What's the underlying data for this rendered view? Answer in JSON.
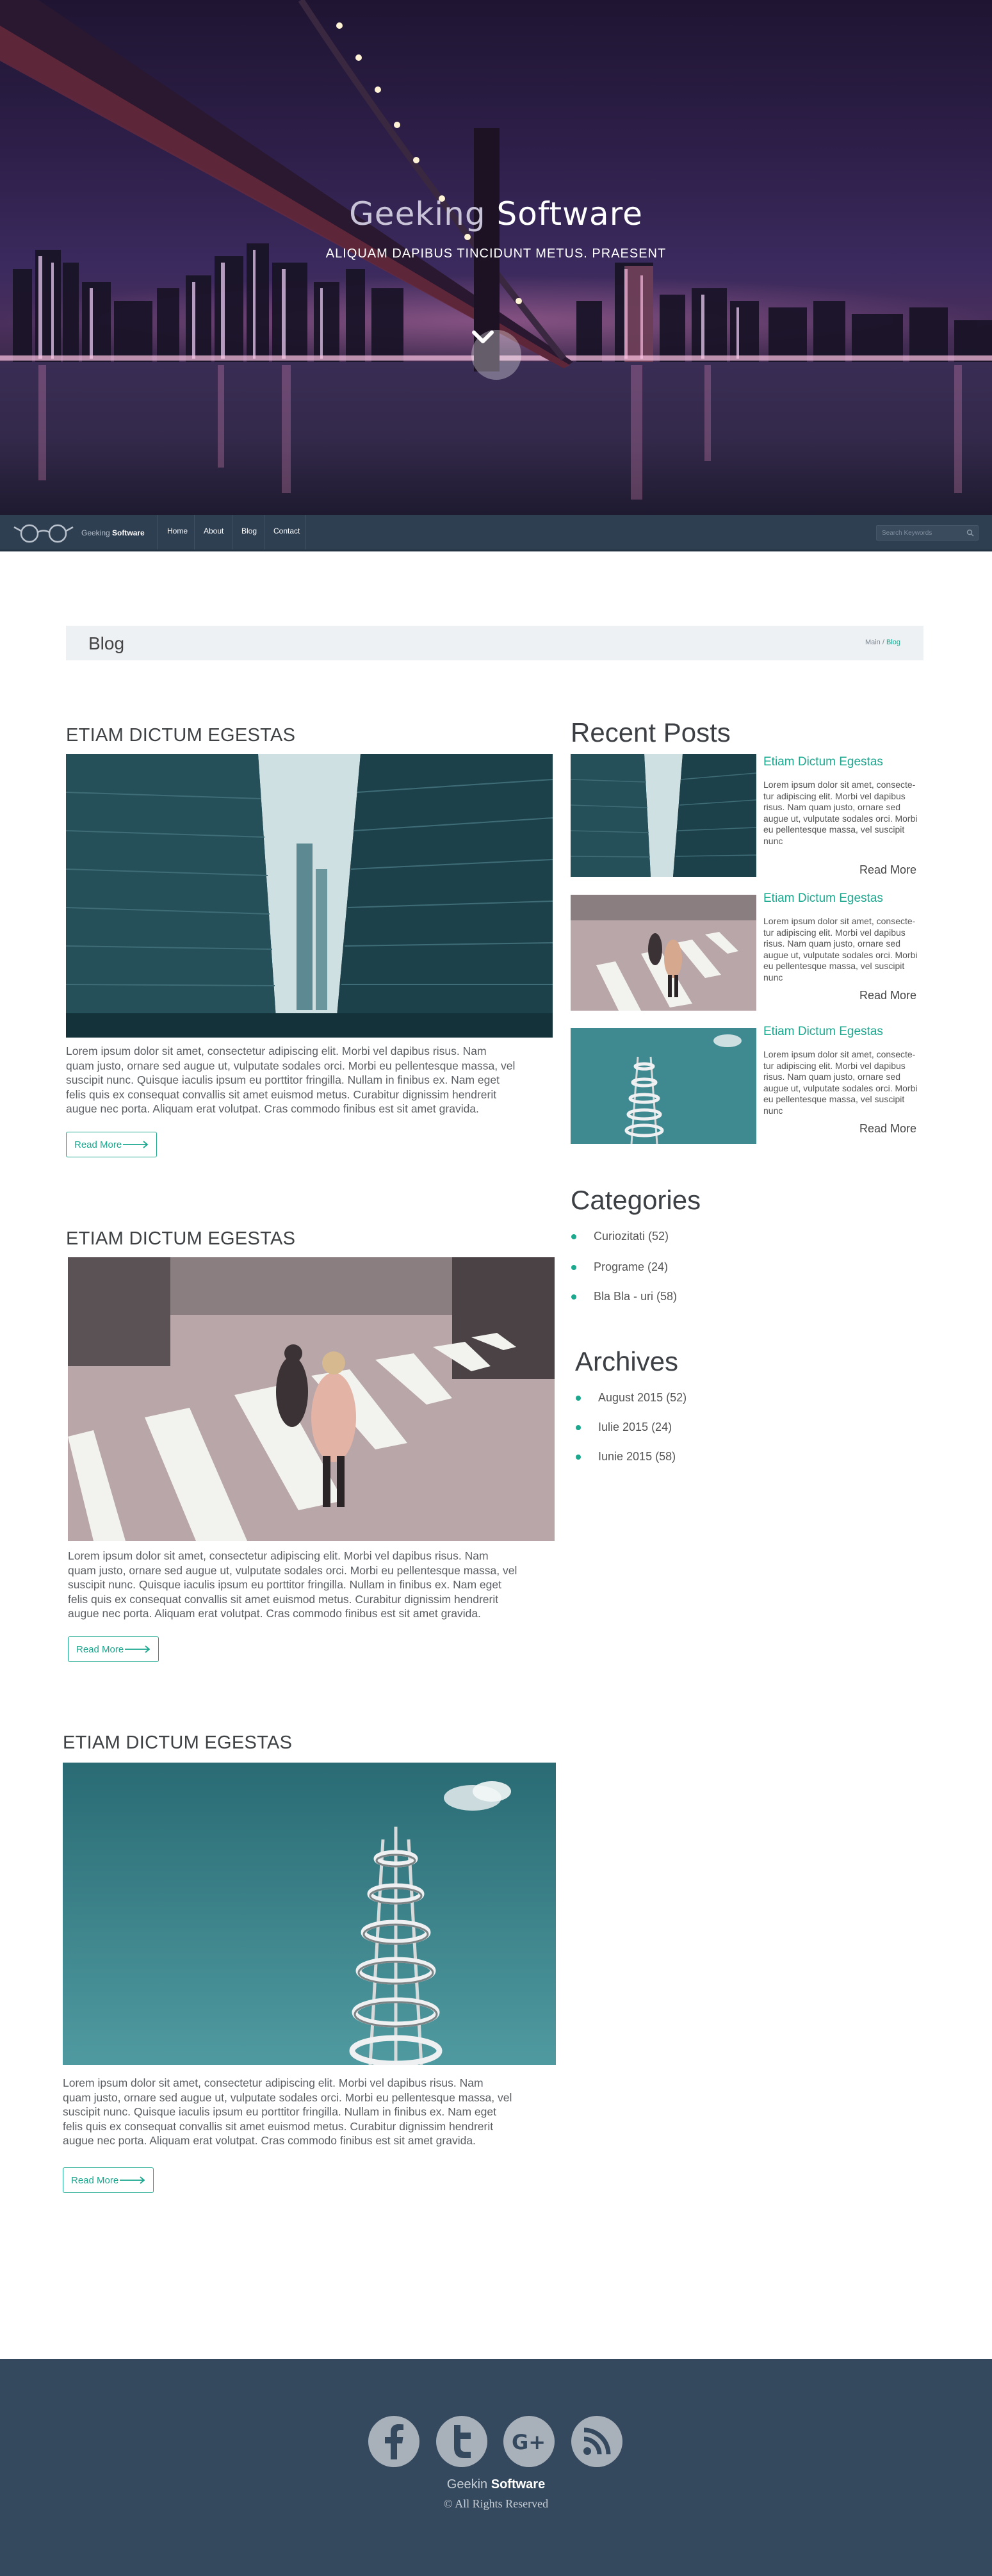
{
  "hero": {
    "title_light": "Geeking",
    "title_bold": " Software",
    "subtitle": "ALIQUAM DAPIBUS TINCIDUNT METUS. PRAESENT"
  },
  "nav": {
    "brand_light": "Geeking",
    "brand_bold": "Software",
    "items": [
      "Home",
      "About",
      "Blog",
      "Contact"
    ],
    "search_placeholder": "Search Keywords"
  },
  "page": {
    "title": "Blog",
    "crumb_main": "Main",
    "crumb_sep": " / ",
    "crumb_current": "Blog"
  },
  "posts": [
    {
      "title": "ETIAM DICTUM EGESTAS",
      "lines": [
        "Lorem ipsum dolor sit amet, consectetur adipiscing elit. Morbi vel dapibus risus. Nam",
        "quam justo, ornare sed augue ut, vulputate sodales orci. Morbi eu pellentesque massa, vel",
        "suscipit nunc. Quisque iaculis ipsum eu porttitor fringilla. Nullam in finibus ex. Nam eget",
        "felis quis ex consequat convallis sit amet euismod metus. Curabitur dignissim hendrerit",
        "augue nec porta. Aliquam erat volutpat. Cras commodo finibus est sit amet gravida."
      ],
      "button": "Read More"
    },
    {
      "title": "ETIAM DICTUM EGESTAS",
      "lines": [
        "Lorem ipsum dolor sit amet, consectetur adipiscing elit. Morbi vel dapibus risus. Nam",
        "quam justo, ornare sed augue ut, vulputate sodales orci. Morbi eu pellentesque massa, vel",
        "suscipit nunc. Quisque iaculis ipsum eu porttitor fringilla. Nullam in finibus ex. Nam eget",
        "felis quis ex consequat convallis sit amet euismod metus. Curabitur dignissim hendrerit",
        "augue nec porta. Aliquam erat volutpat. Cras commodo finibus est sit amet gravida."
      ],
      "button": "Read More"
    },
    {
      "title": "ETIAM DICTUM EGESTAS",
      "lines": [
        "Lorem ipsum dolor sit amet, consectetur adipiscing elit. Morbi vel dapibus risus. Nam",
        "quam justo, ornare sed augue ut, vulputate sodales orci. Morbi eu pellentesque massa, vel",
        "suscipit nunc. Quisque iaculis ipsum eu porttitor fringilla. Nullam in finibus ex. Nam eget",
        "felis quis ex consequat convallis sit amet euismod metus. Curabitur dignissim hendrerit",
        "augue nec porta. Aliquam erat volutpat. Cras commodo finibus est sit amet gravida."
      ],
      "button": "Read More"
    }
  ],
  "sidebar": {
    "recent_heading": "Recent Posts",
    "recent": [
      {
        "title": "Etiam Dictum Egestas",
        "lines": [
          "Lorem ipsum dolor sit amet, consecte-",
          "tur adipiscing elit. Morbi vel dapibus",
          "risus. Nam quam justo, ornare sed",
          "augue ut, vulputate sodales orci. Morbi",
          "eu pellentesque massa, vel suscipit",
          "nunc"
        ],
        "more": "Read More"
      },
      {
        "title": "Etiam Dictum Egestas",
        "lines": [
          "Lorem ipsum dolor sit amet, consecte-",
          "tur adipiscing elit. Morbi vel dapibus",
          "risus. Nam quam justo, ornare sed",
          "augue ut, vulputate sodales orci. Morbi",
          "eu pellentesque massa, vel suscipit",
          "nunc"
        ],
        "more": "Read More"
      },
      {
        "title": "Etiam Dictum Egestas",
        "lines": [
          "Lorem ipsum dolor sit amet, consecte-",
          "tur adipiscing elit. Morbi vel dapibus",
          "risus. Nam quam justo, ornare sed",
          "augue ut, vulputate sodales orci. Morbi",
          "eu pellentesque massa, vel suscipit",
          "nunc"
        ],
        "more": "Read More"
      }
    ],
    "categories_heading": "Categories",
    "categories": [
      "Curiozitati (52)",
      "Programe (24)",
      "Bla Bla - uri (58)"
    ],
    "archives_heading": "Archives",
    "archives": [
      "August 2015 (52)",
      "Iulie 2015 (24)",
      "Iunie 2015 (58)"
    ]
  },
  "footer": {
    "social_icons": [
      "facebook-icon",
      "twitter-icon",
      "google-plus-icon",
      "rss-icon"
    ],
    "google_label": "G+",
    "brand_light": "Geekin",
    "brand_bold": " Software",
    "copyright": "© All Rights Reserved"
  },
  "colors": {
    "accent": "#1ba88f",
    "nav_bg": "#2f3f52",
    "footer_bg": "#34485e",
    "page_bar_bg": "#eef1f4"
  }
}
